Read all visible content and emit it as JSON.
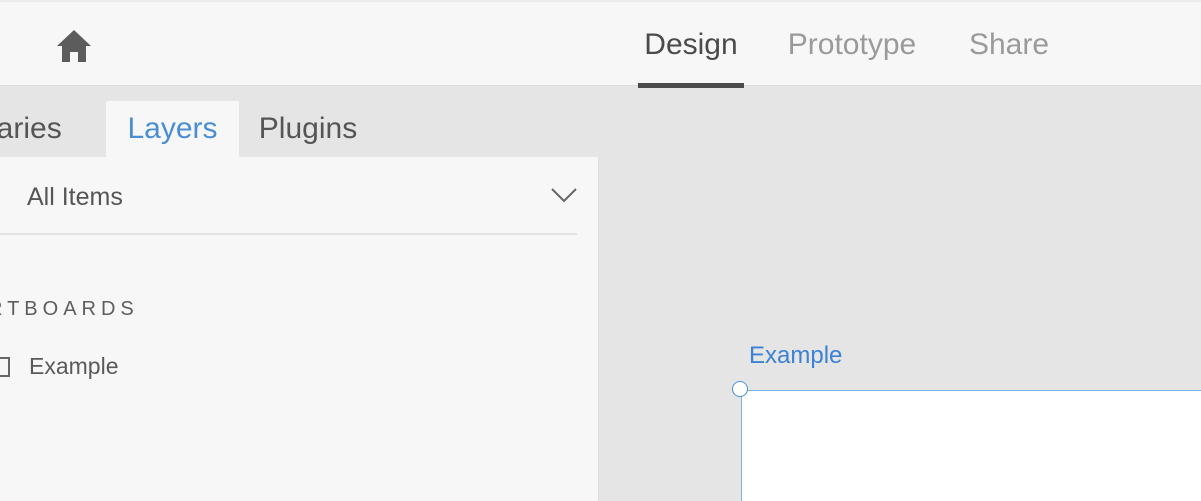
{
  "header": {
    "home_icon": "home-icon",
    "tabs": [
      {
        "label": "Design",
        "active": true
      },
      {
        "label": "Prototype",
        "active": false
      },
      {
        "label": "Share",
        "active": false
      }
    ]
  },
  "panel": {
    "tabs": [
      {
        "label": "braries",
        "active": false
      },
      {
        "label": "Layers",
        "active": true
      },
      {
        "label": "Plugins",
        "active": false
      }
    ],
    "filter": {
      "value": "All Items",
      "icon": "chevron-down-icon"
    },
    "section_heading": "RTBOARDS",
    "layers": [
      {
        "label": "Example",
        "icon": "artboard-icon"
      }
    ]
  },
  "canvas": {
    "artboard_title": "Example"
  },
  "colors": {
    "accent": "#4a8fd4",
    "active_text": "#4b4b4b",
    "inactive_text": "#9a9a9a",
    "panel_bg": "#f7f7f7",
    "canvas_bg": "#e5e5e5"
  }
}
